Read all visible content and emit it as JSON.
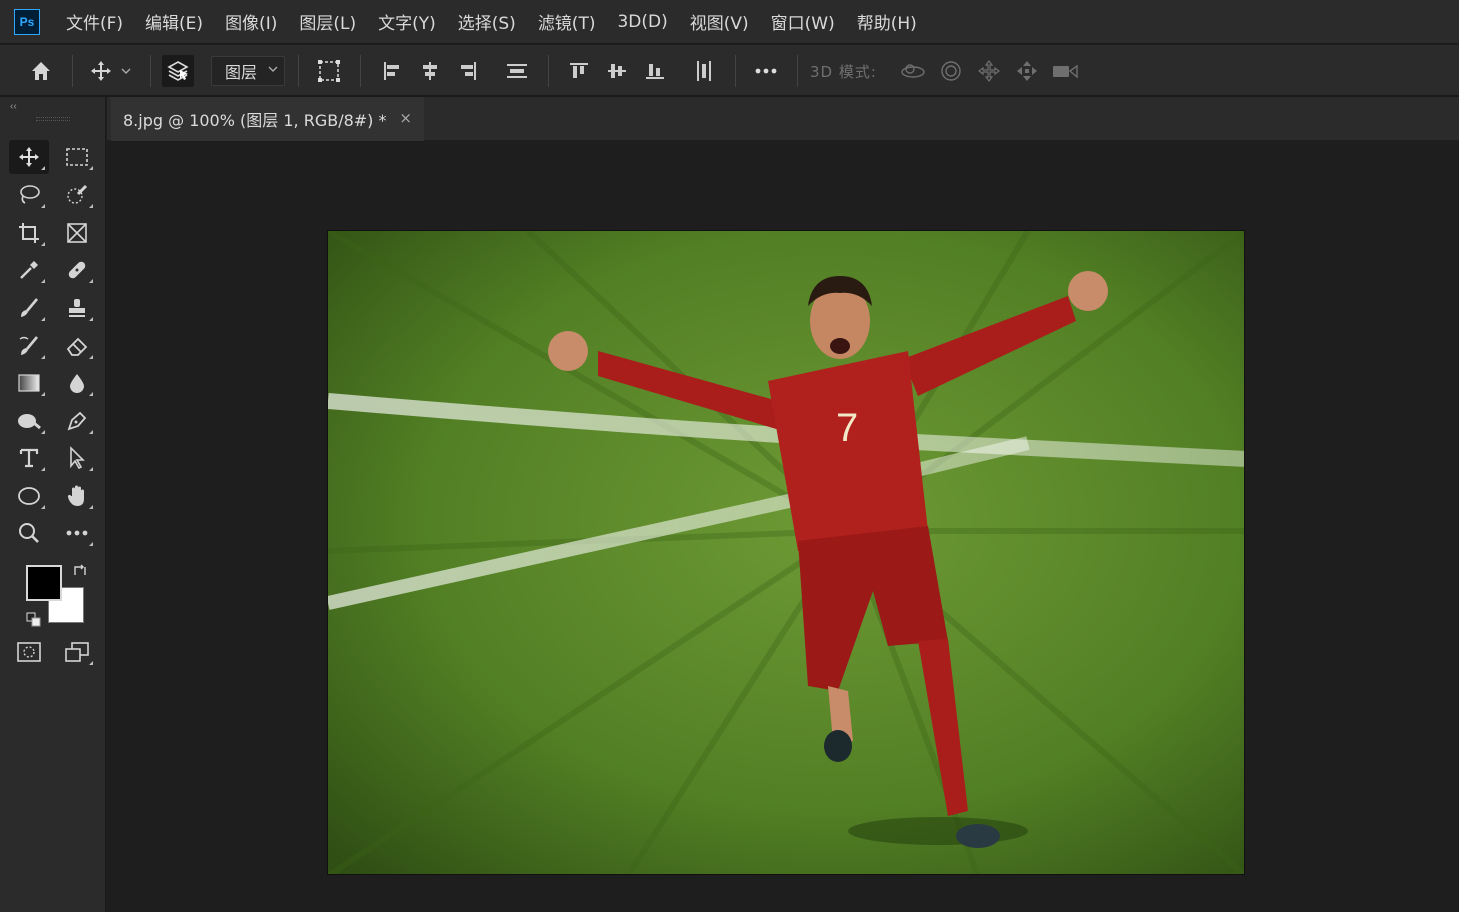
{
  "menubar": {
    "logo": "Ps",
    "items": [
      "文件(F)",
      "编辑(E)",
      "图像(I)",
      "图层(L)",
      "文字(Y)",
      "选择(S)",
      "滤镜(T)",
      "3D(D)",
      "视图(V)",
      "窗口(W)",
      "帮助(H)"
    ]
  },
  "options": {
    "layer_select": "图层",
    "mode_3d_label": "3D 模式:",
    "icons": [
      "home-icon",
      "move-icon",
      "chevron-down-icon",
      "auto-select-layers-icon",
      "transform-controls-icon",
      "align-left-icon",
      "align-hcenter-icon",
      "align-right-icon",
      "distribute-vertical-icon",
      "align-top-icon",
      "align-vcenter-icon",
      "align-bottom-icon",
      "distribute-horizontal-icon",
      "more-options-icon",
      "orbit-3d-icon",
      "roll-3d-icon",
      "drag-3d-icon",
      "slide-3d-icon",
      "scale-3d-camera-icon"
    ]
  },
  "toolbar": {
    "collapse_label": "‹‹",
    "tools": [
      "move-tool",
      "marquee-tool",
      "lasso-tool",
      "quick-selection-tool",
      "crop-tool",
      "frame-tool",
      "eyedropper-tool",
      "healing-brush-tool",
      "brush-tool",
      "clone-stamp-tool",
      "history-brush-tool",
      "eraser-tool",
      "gradient-tool",
      "blur-tool",
      "dodge-tool",
      "pen-tool",
      "type-tool",
      "path-selection-tool",
      "ellipse-tool",
      "hand-tool",
      "zoom-tool",
      "edit-toolbar-tool",
      "quick-mask-tool",
      "screen-mode-tool"
    ],
    "foreground_color": "#000000",
    "background_color": "#ffffff"
  },
  "document": {
    "tab_title": "8.jpg @ 100% (图层 1, RGB/8#) *",
    "close_label": "×"
  },
  "colors": {
    "app_bg": "#1e1e1e",
    "panel_bg": "#2b2b2b",
    "accent": "#31a8ff",
    "grass": "#5c8a2a",
    "jersey_red": "#b0201c"
  }
}
